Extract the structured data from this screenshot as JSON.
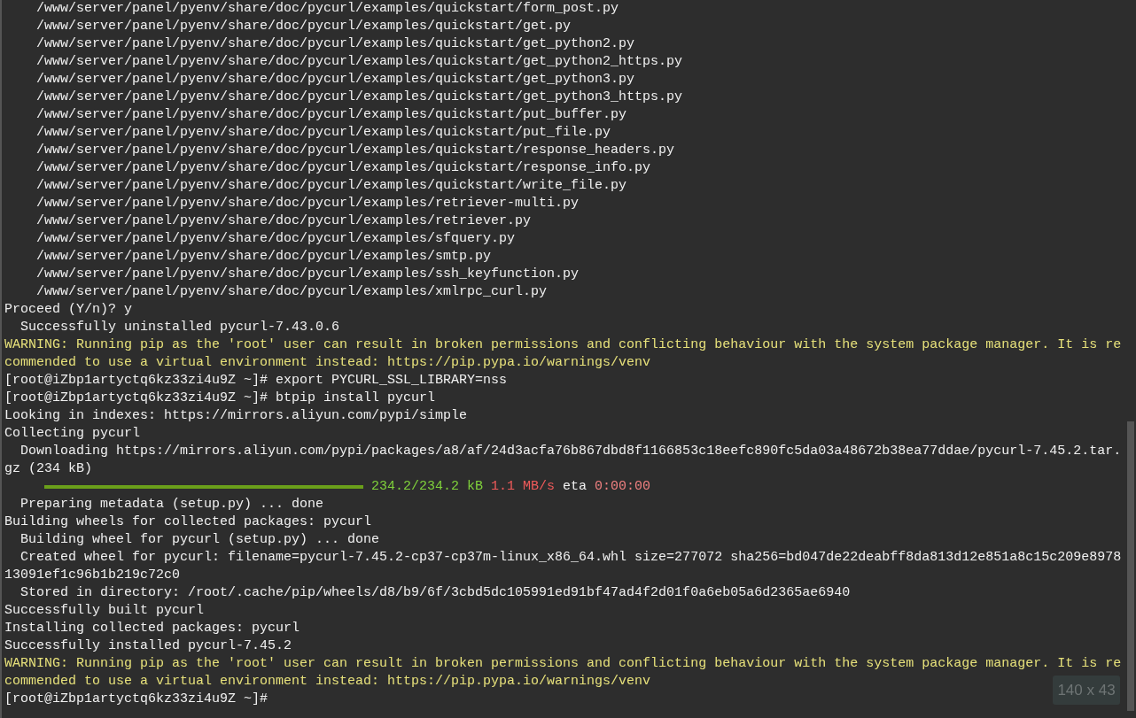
{
  "terminal": {
    "lines": [
      [
        {
          "kind": "text",
          "text": "    /www/server/panel/pyenv/share/doc/pycurl/examples/quickstart/form_post.py"
        }
      ],
      [
        {
          "kind": "text",
          "text": "    /www/server/panel/pyenv/share/doc/pycurl/examples/quickstart/get.py"
        }
      ],
      [
        {
          "kind": "text",
          "text": "    /www/server/panel/pyenv/share/doc/pycurl/examples/quickstart/get_python2.py"
        }
      ],
      [
        {
          "kind": "text",
          "text": "    /www/server/panel/pyenv/share/doc/pycurl/examples/quickstart/get_python2_https.py"
        }
      ],
      [
        {
          "kind": "text",
          "text": "    /www/server/panel/pyenv/share/doc/pycurl/examples/quickstart/get_python3.py"
        }
      ],
      [
        {
          "kind": "text",
          "text": "    /www/server/panel/pyenv/share/doc/pycurl/examples/quickstart/get_python3_https.py"
        }
      ],
      [
        {
          "kind": "text",
          "text": "    /www/server/panel/pyenv/share/doc/pycurl/examples/quickstart/put_buffer.py"
        }
      ],
      [
        {
          "kind": "text",
          "text": "    /www/server/panel/pyenv/share/doc/pycurl/examples/quickstart/put_file.py"
        }
      ],
      [
        {
          "kind": "text",
          "text": "    /www/server/panel/pyenv/share/doc/pycurl/examples/quickstart/response_headers.py"
        }
      ],
      [
        {
          "kind": "text",
          "text": "    /www/server/panel/pyenv/share/doc/pycurl/examples/quickstart/response_info.py"
        }
      ],
      [
        {
          "kind": "text",
          "text": "    /www/server/panel/pyenv/share/doc/pycurl/examples/quickstart/write_file.py"
        }
      ],
      [
        {
          "kind": "text",
          "text": "    /www/server/panel/pyenv/share/doc/pycurl/examples/retriever-multi.py"
        }
      ],
      [
        {
          "kind": "text",
          "text": "    /www/server/panel/pyenv/share/doc/pycurl/examples/retriever.py"
        }
      ],
      [
        {
          "kind": "text",
          "text": "    /www/server/panel/pyenv/share/doc/pycurl/examples/sfquery.py"
        }
      ],
      [
        {
          "kind": "text",
          "text": "    /www/server/panel/pyenv/share/doc/pycurl/examples/smtp.py"
        }
      ],
      [
        {
          "kind": "text",
          "text": "    /www/server/panel/pyenv/share/doc/pycurl/examples/ssh_keyfunction.py"
        }
      ],
      [
        {
          "kind": "text",
          "text": "    /www/server/panel/pyenv/share/doc/pycurl/examples/xmlrpc_curl.py"
        }
      ],
      [
        {
          "kind": "text",
          "text": "Proceed (Y/n)? y"
        }
      ],
      [
        {
          "kind": "text",
          "text": "  Successfully uninstalled pycurl-7.43.0.6"
        }
      ],
      [
        {
          "kind": "text",
          "color": "#e6e07a",
          "text": "WARNING: Running pip as the 'root' user can result in broken permissions and conflicting behaviour with the system package manager. It is re"
        }
      ],
      [
        {
          "kind": "text",
          "color": "#e6e07a",
          "text": "commended to use a virtual environment instead: https://pip.pypa.io/warnings/venv"
        }
      ],
      [
        {
          "kind": "text",
          "text": "[root@iZbp1artyctq6kz33zi4u9Z ~]# export PYCURL_SSL_LIBRARY=nss"
        }
      ],
      [
        {
          "kind": "text",
          "text": "[root@iZbp1artyctq6kz33zi4u9Z ~]# btpip install pycurl"
        }
      ],
      [
        {
          "kind": "text",
          "text": "Looking in indexes: https://mirrors.aliyun.com/pypi/simple"
        }
      ],
      [
        {
          "kind": "text",
          "text": "Collecting pycurl"
        }
      ],
      [
        {
          "kind": "text",
          "text": "  Downloading https://mirrors.aliyun.com/pypi/packages/a8/af/24d3acfa76b867dbd8f1166853c18eefc890fc5da03a48672b38ea77ddae/pycurl-7.45.2.tar."
        }
      ],
      [
        {
          "kind": "text",
          "text": "gz (234 kB)"
        }
      ],
      [
        {
          "kind": "bar",
          "level": 1
        },
        {
          "kind": "text",
          "color": "#7fd13b",
          "text": " 234.2/234.2 kB"
        },
        {
          "kind": "text",
          "color": "#f05a5a",
          "text": " 1.1 MB/s"
        },
        {
          "kind": "text",
          "text": " eta "
        },
        {
          "kind": "text",
          "color": "#f08080",
          "text": "0:00:00"
        }
      ],
      [
        {
          "kind": "text",
          "text": "  Preparing metadata (setup.py) ... done"
        }
      ],
      [
        {
          "kind": "text",
          "text": "Building wheels for collected packages: pycurl"
        }
      ],
      [
        {
          "kind": "text",
          "text": "  Building wheel for pycurl (setup.py) ... done"
        }
      ],
      [
        {
          "kind": "text",
          "text": "  Created wheel for pycurl: filename=pycurl-7.45.2-cp37-cp37m-linux_x86_64.whl size=277072 sha256=bd047de22deabff8da813d12e851a8c15c209e8978"
        }
      ],
      [
        {
          "kind": "text",
          "text": "13091ef1c96b1b219c72c0"
        }
      ],
      [
        {
          "kind": "text",
          "text": "  Stored in directory: /root/.cache/pip/wheels/d8/b9/6f/3cbd5dc105991ed91bf47ad4f2d01f0a6eb05a6d2365ae6940"
        }
      ],
      [
        {
          "kind": "text",
          "text": "Successfully built pycurl"
        }
      ],
      [
        {
          "kind": "text",
          "text": "Installing collected packages: pycurl"
        }
      ],
      [
        {
          "kind": "text",
          "text": "Successfully installed pycurl-7.45.2"
        }
      ],
      [
        {
          "kind": "text",
          "color": "#e6e07a",
          "text": "WARNING: Running pip as the 'root' user can result in broken permissions and conflicting behaviour with the system package manager. It is re"
        }
      ],
      [
        {
          "kind": "text",
          "color": "#e6e07a",
          "text": "commended to use a virtual environment instead: https://pip.pypa.io/warnings/venv"
        }
      ],
      [
        {
          "kind": "text",
          "text": "[root@iZbp1artyctq6kz33zi4u9Z ~]#"
        }
      ]
    ]
  },
  "size_badge": "140 x 43"
}
